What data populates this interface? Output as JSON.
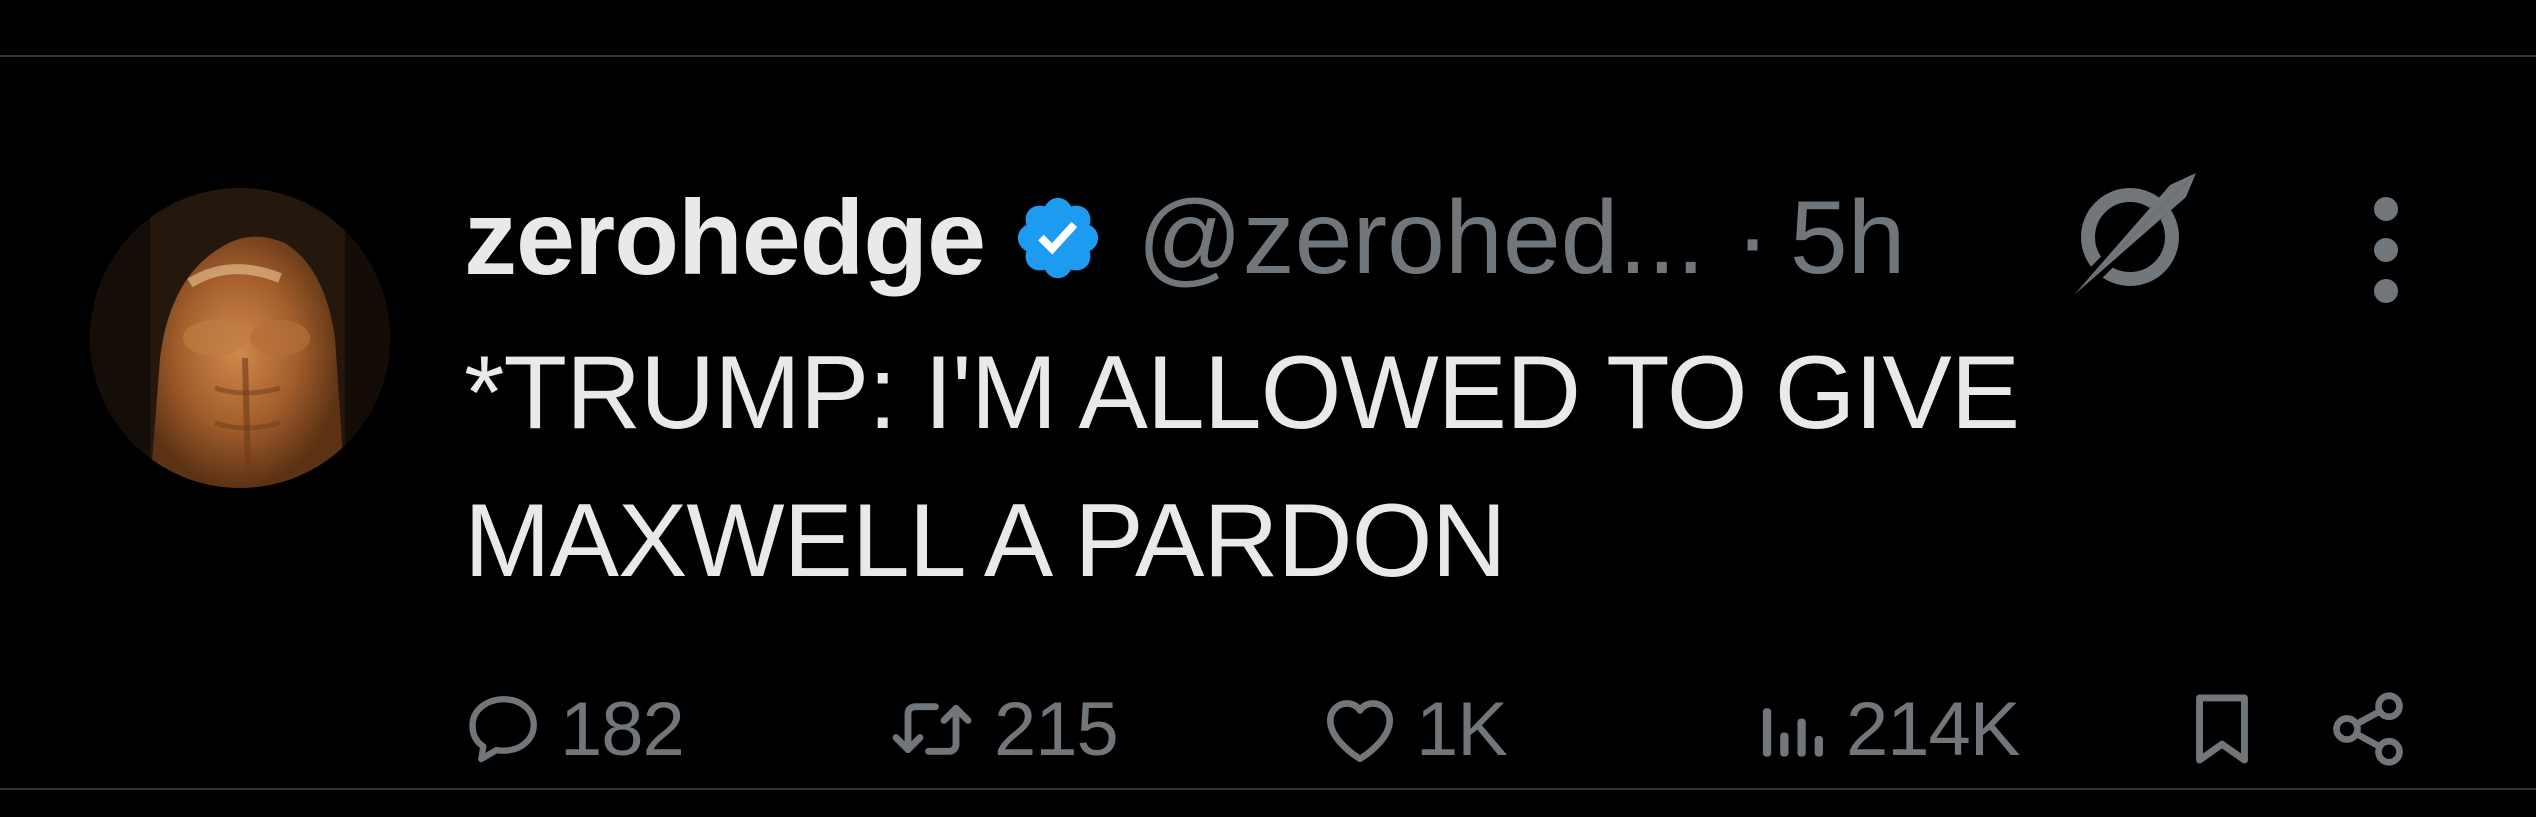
{
  "tweet": {
    "author": {
      "display_name": "zerohedge",
      "handle": "@zerohed...",
      "verified": true
    },
    "separator": "·",
    "time": "5h",
    "text_lines": [
      "*TRUMP: I'M ALLOWED TO GIVE",
      "MAXWELL A PARDON"
    ],
    "stats": {
      "replies": "182",
      "reposts": "215",
      "likes": "1K",
      "views": "214K"
    }
  },
  "icons": {
    "verified": "verified-badge-icon",
    "grok": "grok-icon",
    "more": "more-vertical-icon",
    "reply": "reply-icon",
    "repost": "repost-icon",
    "like": "heart-icon",
    "views": "views-icon",
    "bookmark": "bookmark-icon",
    "share": "share-icon"
  },
  "colors": {
    "background": "#000000",
    "text_primary": "#e7e9ea",
    "text_secondary": "#71767b",
    "verified_blue": "#1d9bf0",
    "divider": "#2f3336"
  }
}
